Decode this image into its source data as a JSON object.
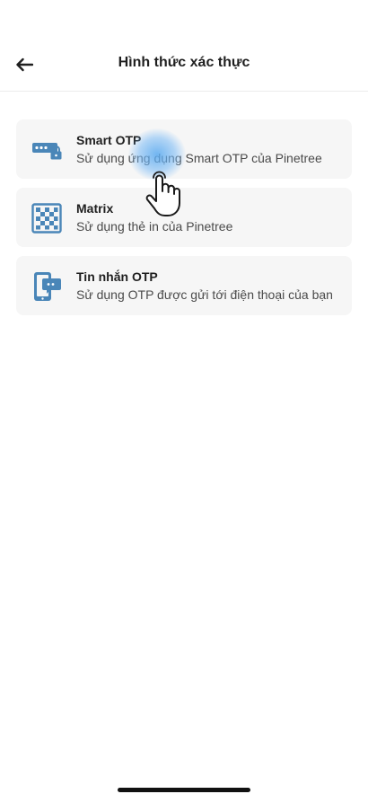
{
  "header": {
    "title": "Hình thức xác thực",
    "back_icon": "arrow-left-icon"
  },
  "options": [
    {
      "title": "Smart OTP",
      "description": "Sử dụng ứng dụng Smart OTP của Pinetree",
      "icon": "password-lock-icon"
    },
    {
      "title": "Matrix",
      "description": "Sử dụng thẻ in của Pinetree",
      "icon": "checker-matrix-icon"
    },
    {
      "title": "Tin nhắn OTP",
      "description": "Sử dụng OTP được gửi tới điện thoại của bạn",
      "icon": "phone-message-icon"
    }
  ],
  "colors": {
    "icon": "#4a86b8",
    "card_background": "#f6f6f6",
    "touch_highlight": "#5aaaf0"
  }
}
